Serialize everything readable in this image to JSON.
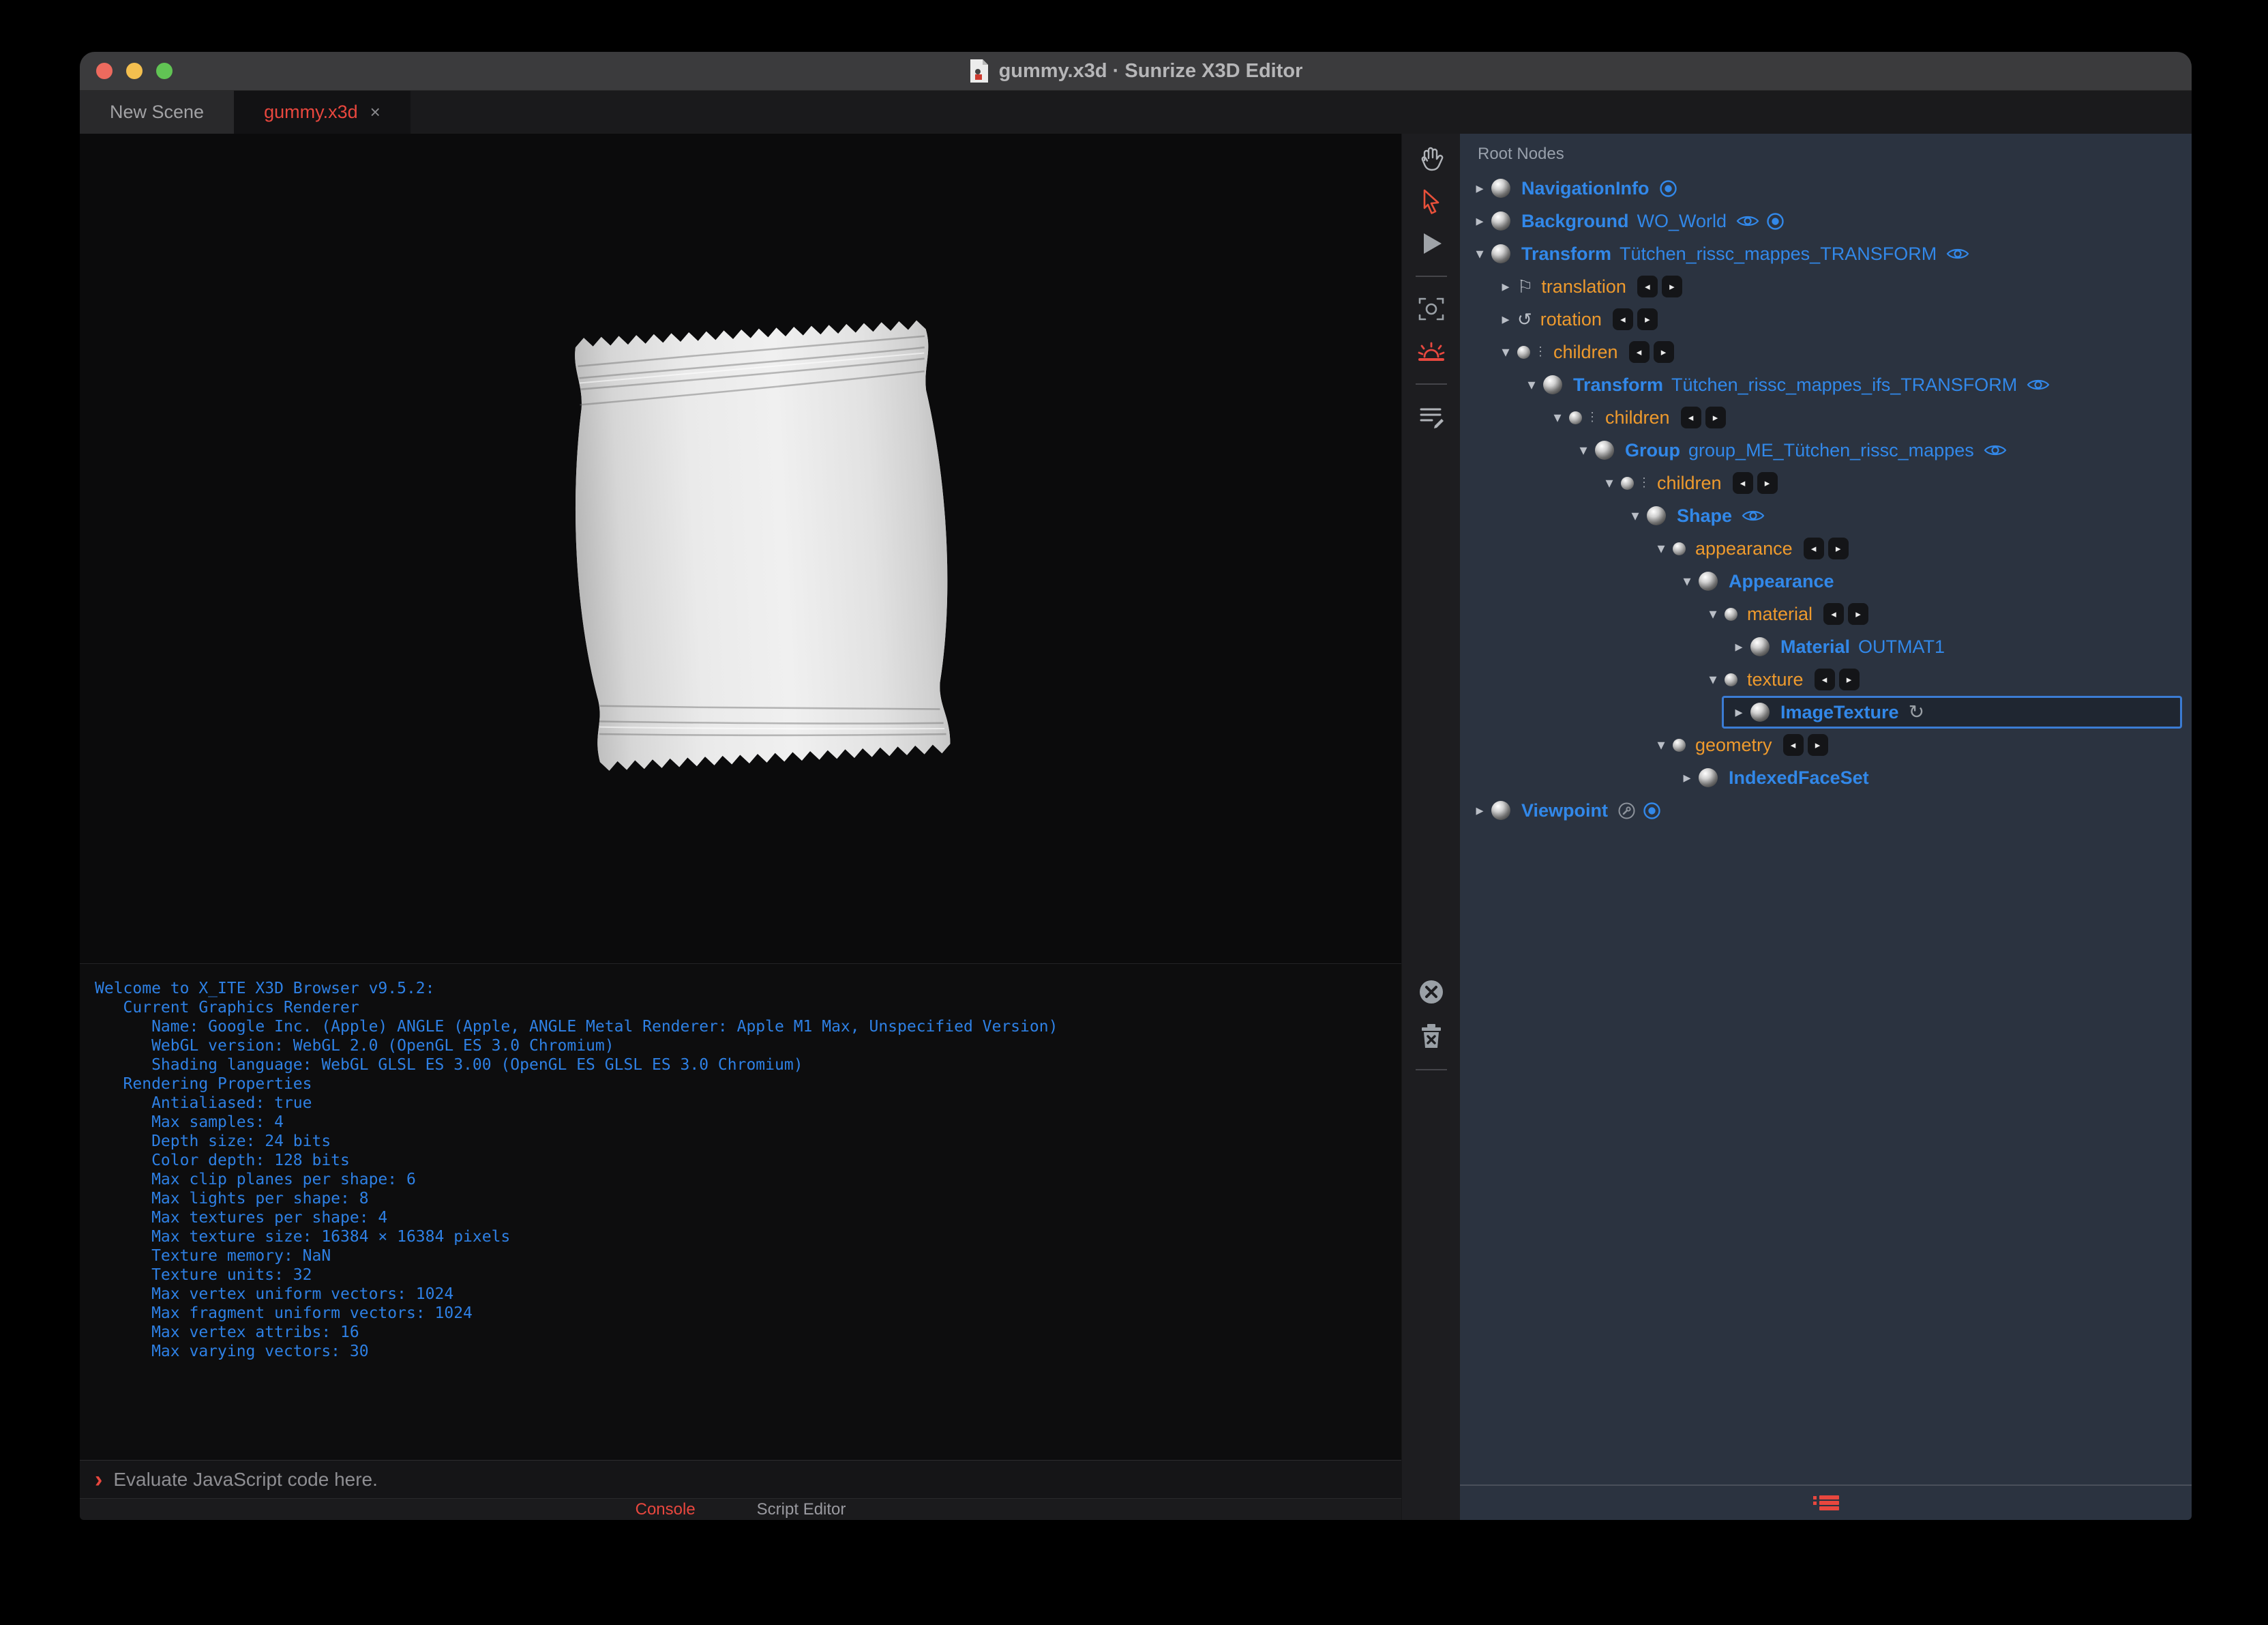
{
  "window": {
    "title": "gummy.x3d · Sunrize X3D Editor"
  },
  "colors": {
    "accent_red": "#e8473e",
    "node_blue": "#3288e9",
    "field_orange": "#ee9a2d",
    "panel_bg": "#2b3340",
    "console_blue": "#2e80e4",
    "traffic_red": "#ed6a5e",
    "traffic_yellow": "#f4bf4f",
    "traffic_green": "#61c454"
  },
  "tabs": [
    {
      "label": "New Scene",
      "active": false
    },
    {
      "label": "gummy.x3d",
      "active": true,
      "close": "×"
    }
  ],
  "toolbar": {
    "tools": [
      "pan-hand",
      "select-arrow",
      "play",
      "divider",
      "viewframe-camera",
      "sunrise",
      "divider",
      "script-edit"
    ],
    "console_tools": [
      "clear-close",
      "trash",
      "divider"
    ]
  },
  "console": {
    "lines": [
      "Welcome to X_ITE X3D Browser v9.5.2:",
      "   Current Graphics Renderer",
      "      Name: Google Inc. (Apple) ANGLE (Apple, ANGLE Metal Renderer: Apple M1 Max, Unspecified Version)",
      "      WebGL version: WebGL 2.0 (OpenGL ES 3.0 Chromium)",
      "      Shading language: WebGL GLSL ES 3.00 (OpenGL ES GLSL ES 3.0 Chromium)",
      "   Rendering Properties",
      "      Antialiased: true",
      "      Max samples: 4",
      "      Depth size: 24 bits",
      "      Color depth: 128 bits",
      "      Max clip planes per shape: 6",
      "      Max lights per shape: 8",
      "      Max textures per shape: 4",
      "      Max texture size: 16384 × 16384 pixels",
      "      Texture memory: NaN",
      "      Texture units: 32",
      "      Max vertex uniform vectors: 1024",
      "      Max fragment uniform vectors: 1024",
      "      Max vertex attribs: 16",
      "      Max varying vectors: 30"
    ]
  },
  "prompt": {
    "chevron": "›",
    "placeholder": "Evaluate JavaScript code here."
  },
  "bottom_tabs": [
    {
      "label": "Console",
      "active": true
    },
    {
      "label": "Script Editor",
      "active": false
    }
  ],
  "outline": {
    "header": "Root Nodes",
    "rows": [
      {
        "level": 0,
        "kind": "node",
        "arrow": "collapsed",
        "type": "NavigationInfo",
        "def": "",
        "suffix": [
          "bound"
        ]
      },
      {
        "level": 0,
        "kind": "node",
        "arrow": "collapsed",
        "type": "Background",
        "def": "WO_World",
        "suffix": [
          "eye",
          "bound"
        ]
      },
      {
        "level": 0,
        "kind": "node",
        "arrow": "expanded",
        "type": "Transform",
        "def": "Tütchen_rissc_mappes_TRANSFORM",
        "suffix": [
          "eye"
        ]
      },
      {
        "level": 1,
        "kind": "field",
        "arrow": "collapsed",
        "icon": "flag",
        "label": "translation",
        "badges": true
      },
      {
        "level": 1,
        "kind": "field",
        "arrow": "collapsed",
        "icon": "rotation",
        "label": "rotation",
        "badges": true
      },
      {
        "level": 1,
        "kind": "field",
        "arrow": "expanded",
        "icon": "children",
        "label": "children",
        "badges": true
      },
      {
        "level": 2,
        "kind": "node",
        "arrow": "expanded",
        "type": "Transform",
        "def": "Tütchen_rissc_mappes_ifs_TRANSFORM",
        "suffix": [
          "eye"
        ]
      },
      {
        "level": 3,
        "kind": "field",
        "arrow": "expanded",
        "icon": "children",
        "label": "children",
        "badges": true
      },
      {
        "level": 4,
        "kind": "node",
        "arrow": "expanded",
        "type": "Group",
        "def": "group_ME_Tütchen_rissc_mappes",
        "suffix": [
          "eye"
        ]
      },
      {
        "level": 5,
        "kind": "field",
        "arrow": "expanded",
        "icon": "children",
        "label": "children",
        "badges": true
      },
      {
        "level": 6,
        "kind": "node",
        "arrow": "expanded",
        "type": "Shape",
        "def": "",
        "suffix": [
          "eye"
        ]
      },
      {
        "level": 7,
        "kind": "field",
        "arrow": "expanded",
        "icon": "dot",
        "label": "appearance",
        "badges": true
      },
      {
        "level": 8,
        "kind": "node",
        "arrow": "expanded",
        "type": "Appearance",
        "def": "",
        "suffix": []
      },
      {
        "level": 9,
        "kind": "field",
        "arrow": "expanded",
        "icon": "dot",
        "label": "material",
        "badges": true
      },
      {
        "level": 10,
        "kind": "node",
        "arrow": "collapsed",
        "type": "Material",
        "def": "OUTMAT1",
        "suffix": []
      },
      {
        "level": 9,
        "kind": "field",
        "arrow": "expanded",
        "icon": "dot",
        "label": "texture",
        "badges": true
      },
      {
        "level": 10,
        "kind": "node",
        "arrow": "collapsed",
        "type": "ImageTexture",
        "def": "",
        "suffix": [
          "refresh"
        ],
        "selected": true
      },
      {
        "level": 7,
        "kind": "field",
        "arrow": "expanded",
        "icon": "dot",
        "label": "geometry",
        "badges": true
      },
      {
        "level": 8,
        "kind": "node",
        "arrow": "collapsed",
        "type": "IndexedFaceSet",
        "def": "",
        "suffix": []
      },
      {
        "level": 0,
        "kind": "node",
        "arrow": "collapsed",
        "type": "Viewpoint",
        "def": "",
        "suffix": [
          "wrench",
          "bound"
        ]
      }
    ]
  }
}
